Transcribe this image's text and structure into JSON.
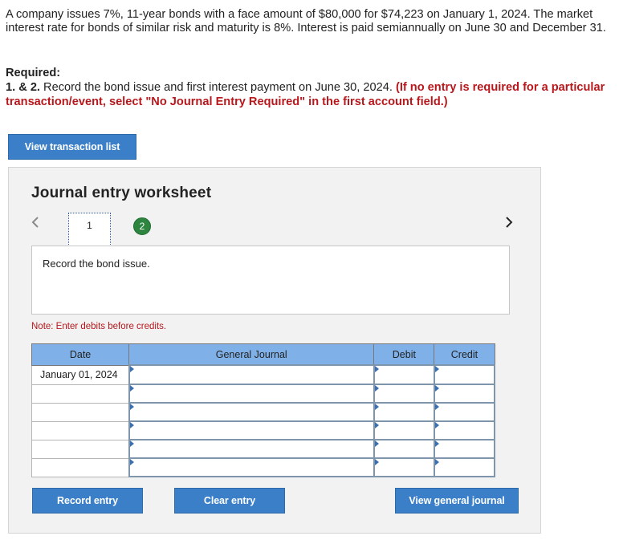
{
  "problem": {
    "text": "A company issues 7%, 11-year bonds with a face amount of $80,000 for $74,223 on January 1, 2024. The market interest rate for bonds of similar risk and maturity is 8%. Interest is paid semiannually on June 30 and December 31."
  },
  "required": {
    "heading": "Required:",
    "number": "1. & 2.",
    "instruction": " Record the bond issue and first interest payment on June 30, 2024. ",
    "note": "(If no entry is required for a particular transaction/event, select \"No Journal Entry Required\" in the first account field.)"
  },
  "buttons": {
    "view_transaction_list": "View transaction list",
    "record_entry": "Record entry",
    "clear_entry": "Clear entry",
    "view_general_journal": "View general journal"
  },
  "worksheet": {
    "title": "Journal entry worksheet",
    "steps": [
      "1",
      "2"
    ],
    "active_step": "1",
    "description": "Record the bond issue.",
    "note": "Note: Enter debits before credits."
  },
  "table": {
    "headers": {
      "date": "Date",
      "journal": "General Journal",
      "debit": "Debit",
      "credit": "Credit"
    },
    "rows": [
      {
        "date": "January 01, 2024",
        "account": "",
        "debit": "",
        "credit": ""
      },
      {
        "date": "",
        "account": "",
        "debit": "",
        "credit": ""
      },
      {
        "date": "",
        "account": "",
        "debit": "",
        "credit": ""
      },
      {
        "date": "",
        "account": "",
        "debit": "",
        "credit": ""
      },
      {
        "date": "",
        "account": "",
        "debit": "",
        "credit": ""
      },
      {
        "date": "",
        "account": "",
        "debit": "",
        "credit": ""
      }
    ]
  },
  "colors": {
    "button_blue": "#3a7fc7",
    "header_blue": "#7fb1e8",
    "note_red": "#b8171c",
    "step_green": "#2e8540"
  }
}
